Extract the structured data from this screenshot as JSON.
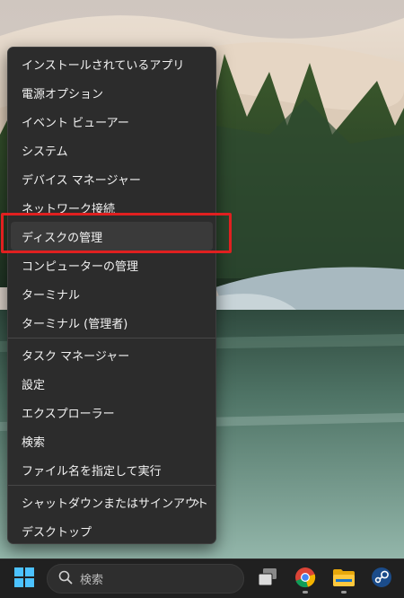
{
  "menu": {
    "items": [
      {
        "label": "インストールされているアプリ"
      },
      {
        "label": "電源オプション"
      },
      {
        "label": "イベント ビューアー"
      },
      {
        "label": "システム"
      },
      {
        "label": "デバイス マネージャー"
      },
      {
        "label": "ネットワーク接続"
      },
      {
        "label": "ディスクの管理"
      },
      {
        "label": "コンピューターの管理"
      },
      {
        "label": "ターミナル"
      },
      {
        "label": "ターミナル (管理者)"
      },
      {
        "label": "タスク マネージャー"
      },
      {
        "label": "設定"
      },
      {
        "label": "エクスプローラー"
      },
      {
        "label": "検索"
      },
      {
        "label": "ファイル名を指定して実行"
      },
      {
        "label": "シャットダウンまたはサインアウト"
      },
      {
        "label": "デスクトップ"
      }
    ],
    "highlighted_item": "ディスクの管理",
    "submenu_icon": "chevron-right-icon"
  },
  "taskbar": {
    "start_icon": "windows-start-icon",
    "search_placeholder": "検索",
    "search_icon": "search-icon",
    "apps": [
      {
        "icon": "task-view-icon"
      },
      {
        "icon": "chrome-icon",
        "running": true
      },
      {
        "icon": "file-explorer-icon",
        "running": true
      },
      {
        "icon": "steam-icon"
      }
    ]
  },
  "colors": {
    "menu_bg": "#2c2c2c",
    "highlight": "#3a3a3a",
    "annotation_red": "#e02020",
    "taskbar_bg": "#202020",
    "windows_blue": "#4cc2ff"
  }
}
